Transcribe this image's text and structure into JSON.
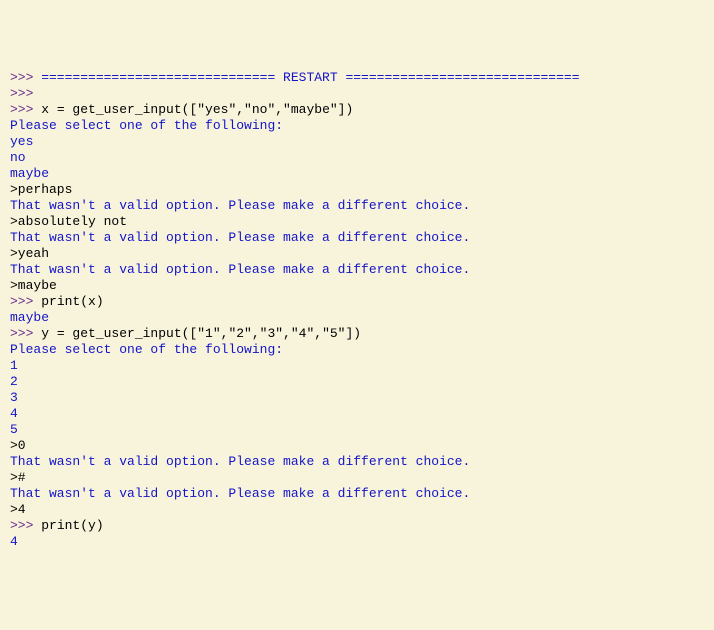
{
  "colors": {
    "background": "#f8f4dc",
    "prompt": "#6b2a8a",
    "code": "#000000",
    "output": "#1414c8"
  },
  "prompt_token": ">>>",
  "restart_left": " ============================== ",
  "restart_word": "RESTART",
  "restart_right": " ==============================",
  "lines": {
    "l0_a": ">>>",
    "l0_b": " ============================== ",
    "l0_c": "RESTART",
    "l0_d": " ==============================",
    "l1": ">>>",
    "l2_a": ">>> ",
    "l2_b": "x = get_user_input([\"yes\",\"no\",\"maybe\"])",
    "l3": "Please select one of the following:",
    "l4": "yes",
    "l5": "no",
    "l6": "maybe",
    "l7": ">perhaps",
    "l8": "That wasn't a valid option. Please make a different choice.",
    "l9": ">absolutely not",
    "l10": "That wasn't a valid option. Please make a different choice.",
    "l11": ">yeah",
    "l12": "That wasn't a valid option. Please make a different choice.",
    "l13": ">maybe",
    "l14_a": ">>> ",
    "l14_b": "print(x)",
    "l15": "maybe",
    "l16_a": ">>> ",
    "l16_b": "y = get_user_input([\"1\",\"2\",\"3\",\"4\",\"5\"])",
    "l17": "Please select one of the following:",
    "l18": "1",
    "l19": "2",
    "l20": "3",
    "l21": "4",
    "l22": "5",
    "l23": ">0",
    "l24": "That wasn't a valid option. Please make a different choice.",
    "l25": ">#",
    "l26": "That wasn't a valid option. Please make a different choice.",
    "l27": ">4",
    "l28_a": ">>> ",
    "l28_b": "print(y)",
    "l29": "4"
  }
}
